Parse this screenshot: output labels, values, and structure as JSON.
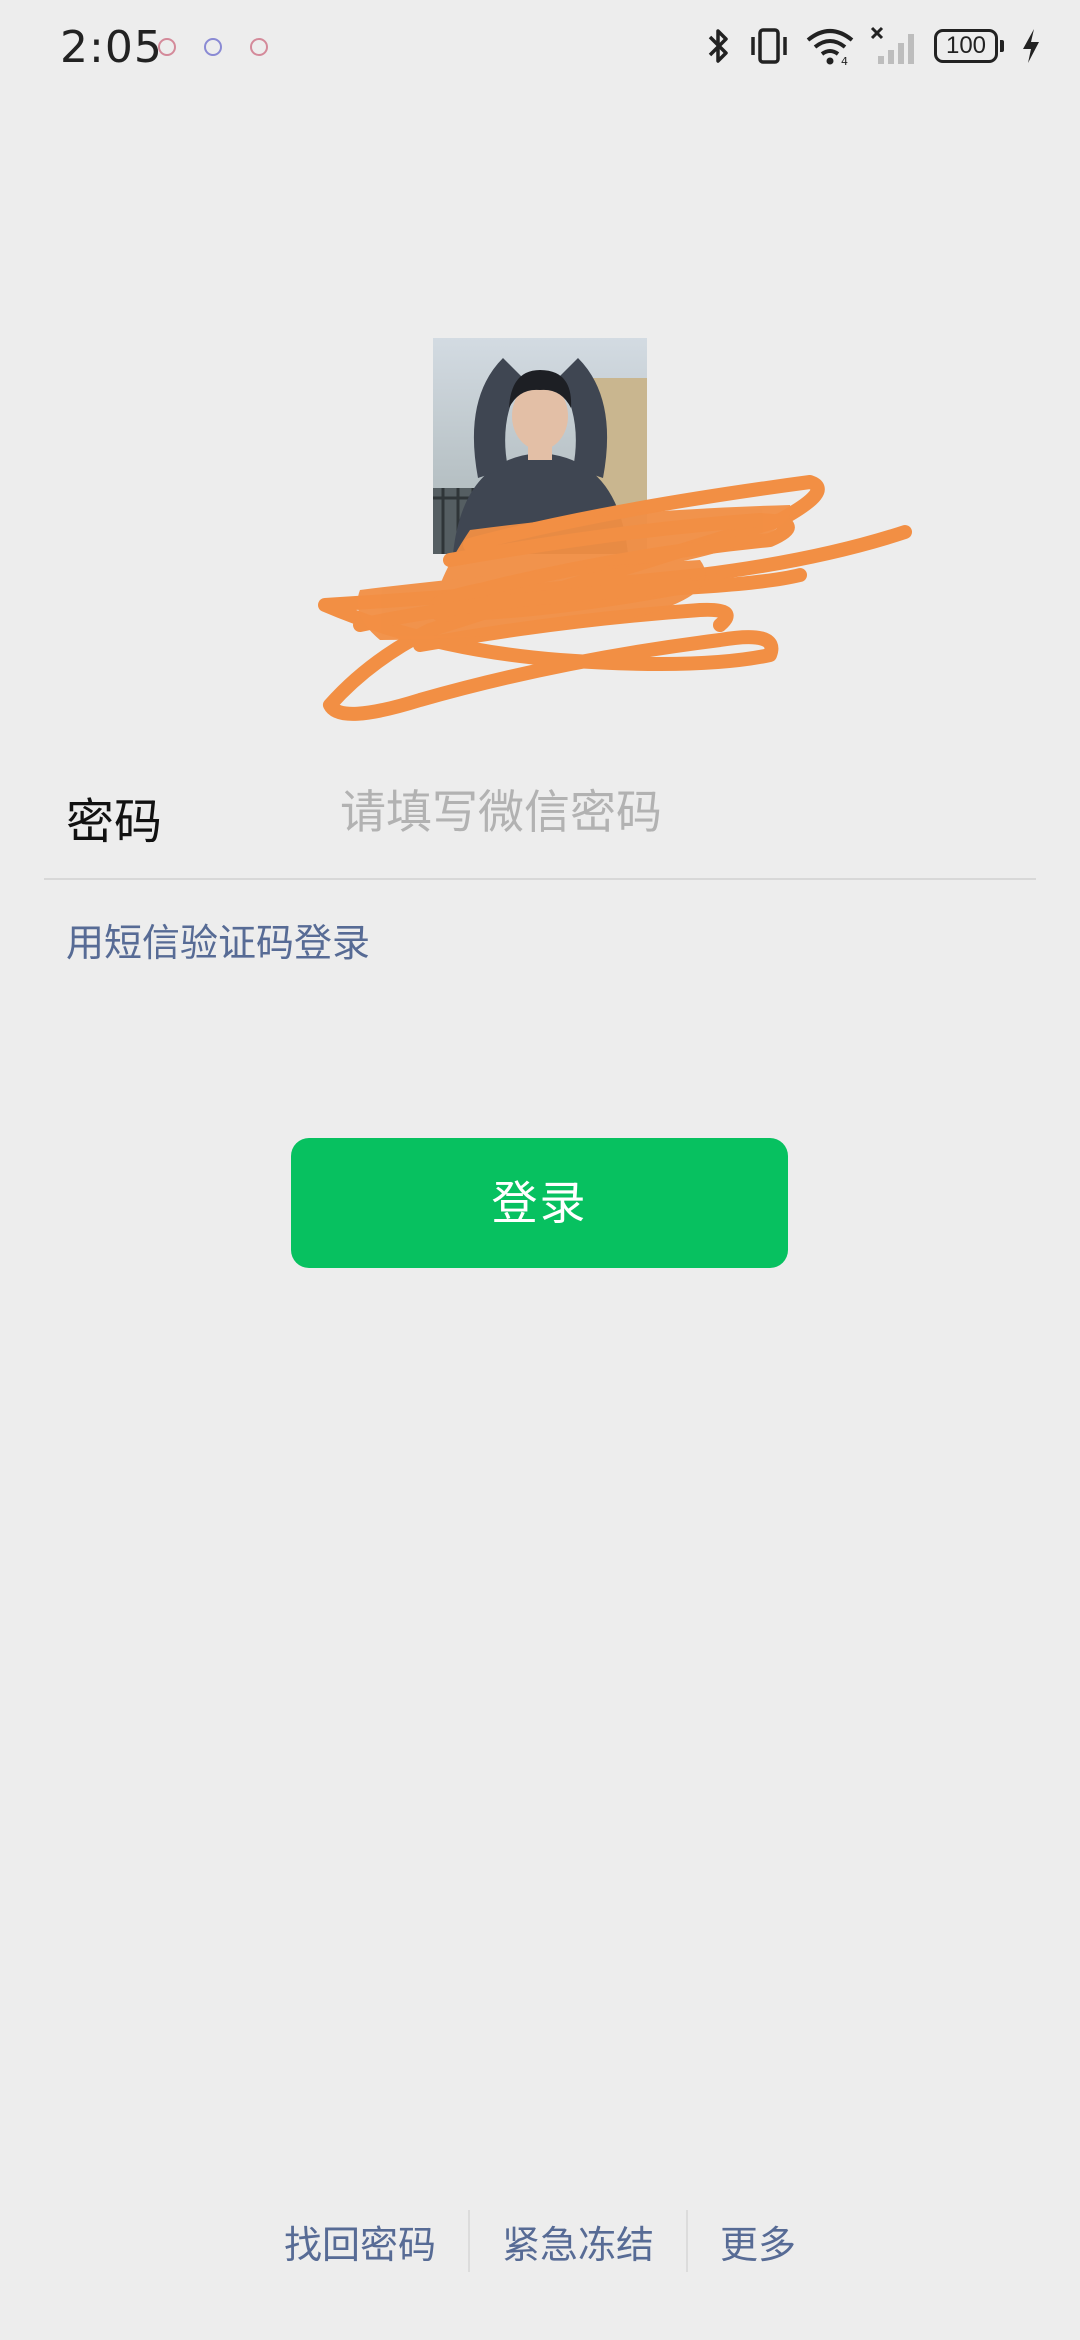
{
  "status_bar": {
    "time": "2:05",
    "battery": "100",
    "icons": [
      "notification-icon",
      "notification-icon",
      "notification-icon",
      "bluetooth-icon",
      "vibrate-icon",
      "wifi-icon",
      "no-signal-icon",
      "battery-icon",
      "charging-icon"
    ]
  },
  "login": {
    "password_label": "密码",
    "password_placeholder": "请填写微信密码",
    "sms_login_link": "用短信验证码登录",
    "login_button": "登录"
  },
  "footer": {
    "links": [
      "找回密码",
      "紧急冻结",
      "更多"
    ]
  },
  "colors": {
    "background": "#ededed",
    "primary_green": "#07c160",
    "link_blue": "#576b95",
    "scribble_orange": "#f28f44"
  }
}
